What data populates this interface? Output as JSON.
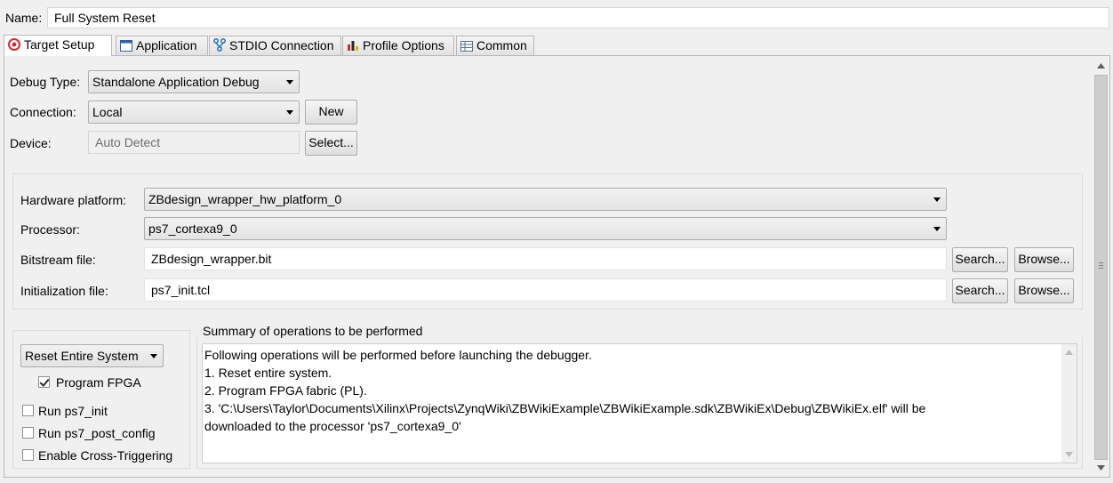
{
  "name_row": {
    "label": "Name:",
    "value": "Full System Reset"
  },
  "tabs": [
    {
      "label": "Target Setup",
      "icon": "target-icon"
    },
    {
      "label": "Application",
      "icon": "application-window-icon"
    },
    {
      "label": "STDIO Connection",
      "icon": "connection-branch-icon"
    },
    {
      "label": "Profile Options",
      "icon": "profile-chart-icon"
    },
    {
      "label": "Common",
      "icon": "common-table-icon"
    }
  ],
  "target": {
    "debug_type_label": "Debug Type:",
    "debug_type_value": "Standalone Application Debug",
    "connection_label": "Connection:",
    "connection_value": "Local",
    "new_button": "New",
    "device_label": "Device:",
    "device_value": "Auto Detect",
    "select_button": "Select..."
  },
  "hardware": {
    "platform_label": "Hardware platform:",
    "platform_value": "ZBdesign_wrapper_hw_platform_0",
    "processor_label": "Processor:",
    "processor_value": "ps7_cortexa9_0",
    "bitstream_label": "Bitstream file:",
    "bitstream_value": "ZBdesign_wrapper.bit",
    "init_label": "Initialization file:",
    "init_value": "ps7_init.tcl",
    "search_button": "Search...",
    "browse_button": "Browse..."
  },
  "options": {
    "reset_value": "Reset Entire System",
    "program_fpga": "Program FPGA",
    "run_ps7_init": "Run ps7_init",
    "run_ps7_post_config": "Run ps7_post_config",
    "enable_cross_triggering": "Enable Cross-Triggering"
  },
  "summary": {
    "title": "Summary of operations to be performed",
    "lines": [
      "Following operations will be performed before launching the debugger.",
      "1. Reset entire system.",
      "2. Program FPGA fabric (PL).",
      "3. 'C:\\Users\\Taylor\\Documents\\Xilinx\\Projects\\ZynqWiki\\ZBWikiExample\\ZBWikiExample.sdk\\ZBWikiEx\\Debug\\ZBWikiEx.elf' will be",
      "downloaded to the processor 'ps7_cortexa9_0'"
    ]
  },
  "colors": {
    "target_icon": "#d9262c",
    "branch_icon": "#2a7ac0",
    "checkbox_border": "#8e8f8f"
  }
}
